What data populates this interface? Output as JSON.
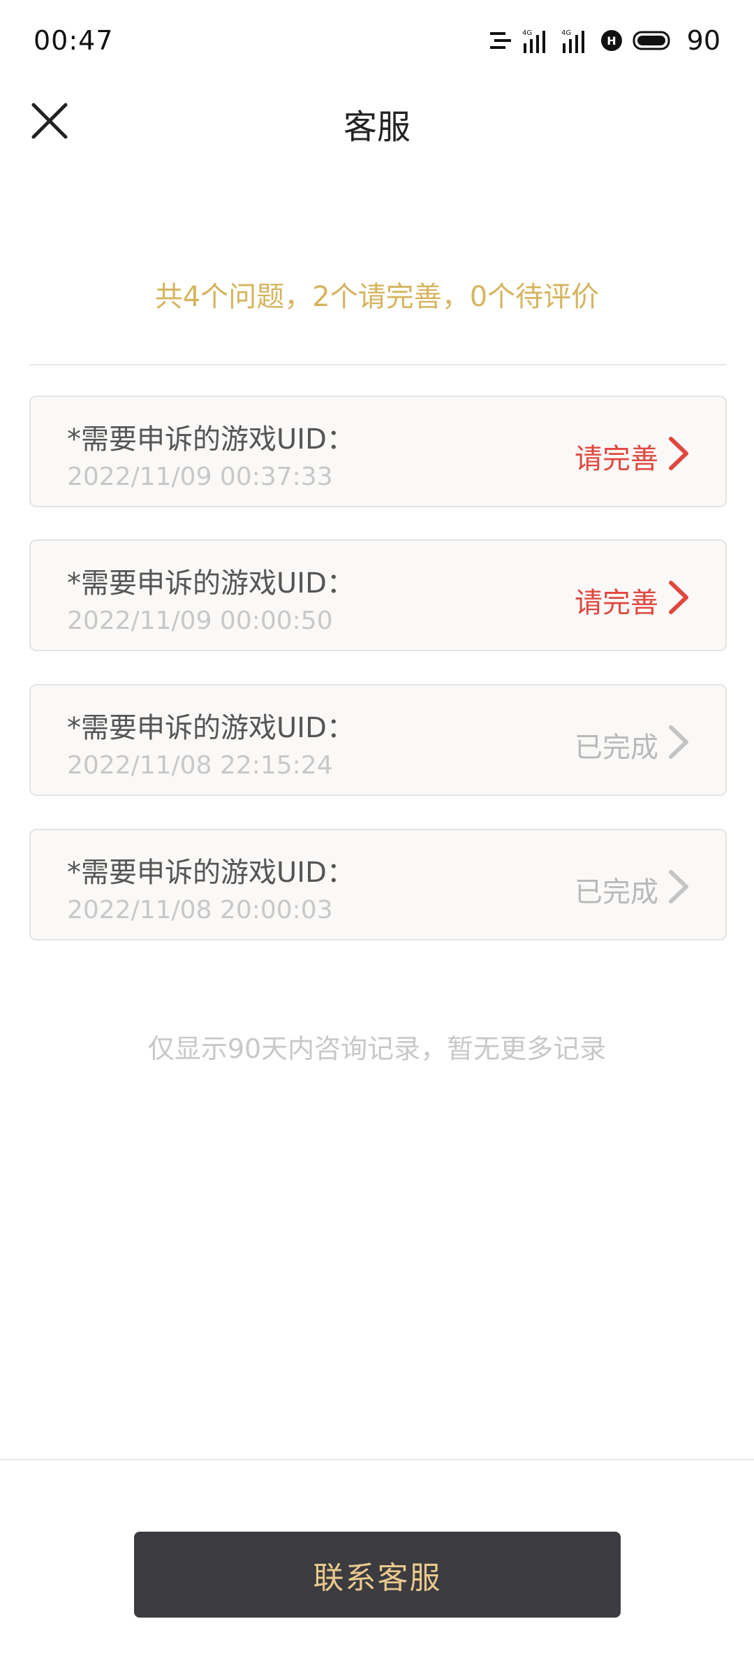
{
  "status_bar": {
    "time": "00:47",
    "battery": "90",
    "icons": [
      "notification-lines-icon",
      "signal-4g-icon",
      "signal-4g-icon",
      "hd-icon",
      "battery-icon"
    ]
  },
  "nav": {
    "title": "客服",
    "close_icon": "close-icon"
  },
  "summary": "共4个问题，2个请完善，0个待评价",
  "tickets": [
    {
      "title": "*需要申诉的游戏UID：",
      "time": "2022/11/09 00:37:33",
      "status": "请完善",
      "status_type": "pending"
    },
    {
      "title": "*需要申诉的游戏UID：",
      "time": "2022/11/09 00:00:50",
      "status": "请完善",
      "status_type": "pending"
    },
    {
      "title": "*需要申诉的游戏UID：",
      "time": "2022/11/08 22:15:24",
      "status": "已完成",
      "status_type": "done"
    },
    {
      "title": "*需要申诉的游戏UID：",
      "time": "2022/11/08 20:00:03",
      "status": "已完成",
      "status_type": "done"
    }
  ],
  "footer_note": "仅显示90天内咨询记录，暂无更多记录",
  "contact_button": "联系客服",
  "colors": {
    "summary": "#d6b45e",
    "pending": "#e0473f",
    "done": "#b9b9b9",
    "button_bg": "#3b3b40",
    "button_text": "#e9c98c"
  }
}
